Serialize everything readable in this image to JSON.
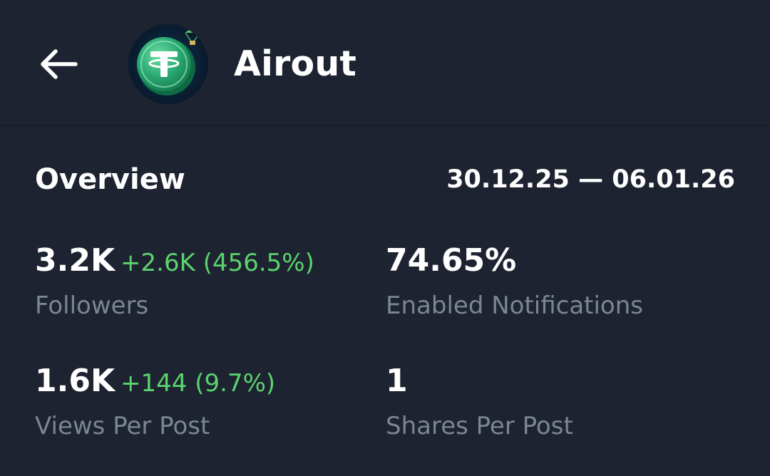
{
  "header": {
    "back_icon": "arrow-left-icon",
    "avatar_icon": "tether-coin-parachute-icon",
    "title": "Airout"
  },
  "overview": {
    "heading": "Overview",
    "date_range": "30.12.25 — 06.01.26",
    "stats": [
      {
        "value": "3.2K",
        "delta": "+2.6K (456.5%)",
        "label": "Followers"
      },
      {
        "value": "74.65%",
        "delta": "",
        "label": "Enabled Notifications"
      },
      {
        "value": "1.6K",
        "delta": "+144 (9.7%)",
        "label": "Views Per Post"
      },
      {
        "value": "1",
        "delta": "",
        "label": "Shares Per Post"
      }
    ]
  },
  "colors": {
    "background": "#1d2330",
    "positive_delta": "#5bd36e",
    "muted_label": "#7b8593",
    "text": "#ffffff"
  }
}
